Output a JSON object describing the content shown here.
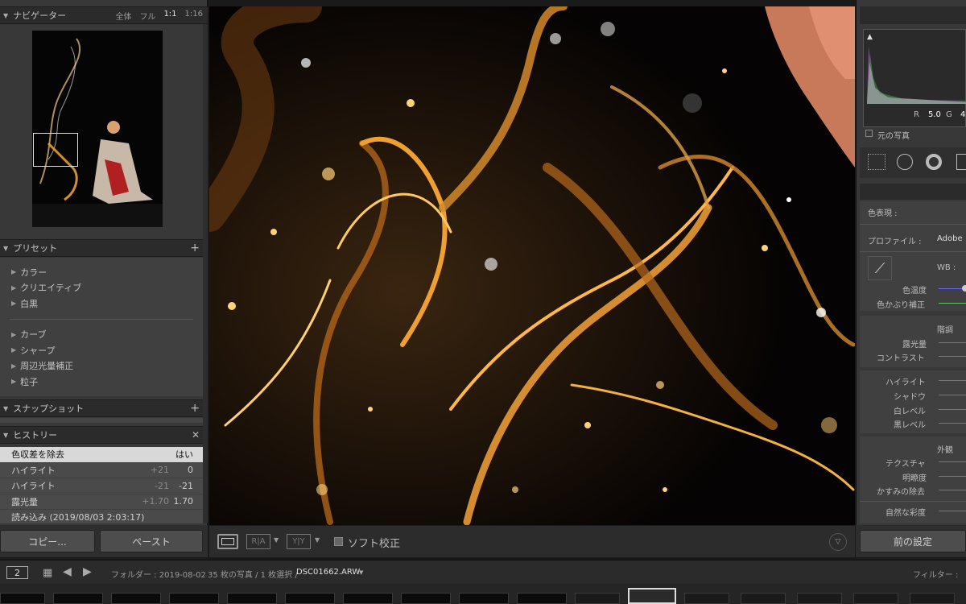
{
  "navigator": {
    "title": "ナビゲーター",
    "options": [
      "全体",
      "フル",
      "1:1",
      "1:16"
    ],
    "active_option": "1:1"
  },
  "presets": {
    "title": "プリセット",
    "group1": [
      "カラー",
      "クリエイティブ",
      "白黒"
    ],
    "group2": [
      "カーブ",
      "シャープ",
      "周辺光量補正",
      "粒子"
    ]
  },
  "snapshot": {
    "title": "スナップショット"
  },
  "history": {
    "title": "ヒストリー",
    "rows": [
      {
        "name": "色収差を除去",
        "delta": "",
        "value": "はい",
        "selected": true
      },
      {
        "name": "ハイライト",
        "delta": "+21",
        "value": "0"
      },
      {
        "name": "ハイライト",
        "delta": "-21",
        "value": "-21"
      },
      {
        "name": "露光量",
        "delta": "+1.70",
        "value": "1.70"
      },
      {
        "name": "読み込み (2019/08/03 2:03:17)",
        "delta": "",
        "value": ""
      }
    ]
  },
  "buttons": {
    "copy": "コピー...",
    "paste": "ペースト",
    "previous": "前の設定"
  },
  "toolbar": {
    "soft_proof": "ソフト校正"
  },
  "right": {
    "histogram_readout": {
      "r_label": "R",
      "r_value": "5.0",
      "g_label": "G",
      "g_value": "4"
    },
    "original_photo": "元の写真",
    "color_rep": "色表現 :",
    "profile_label": "プロファイル :",
    "profile_value": "Adobe",
    "wb": "WB :",
    "temp": "色温度",
    "tint": "色かぶり補正",
    "tone": "階調",
    "exposure": "露光量",
    "contrast": "コントラスト",
    "highlights": "ハイライト",
    "shadows": "シャドウ",
    "whites": "白レベル",
    "blacks": "黒レベル",
    "presence": "外観",
    "texture": "テクスチャ",
    "clarity": "明瞭度",
    "dehaze": "かすみの除去",
    "vibrance": "自然な彩度"
  },
  "filmstrip": {
    "screen_num": "2",
    "folder": "フォルダー : 2019-08-02",
    "count": "35 枚の写真 / 1 枚選択 /",
    "filename": "DSC01662.ARW",
    "filter": "フィルター :"
  },
  "colors": {
    "accent_selected": "#d8d8d8",
    "panel": "#383838",
    "flame": "#e8a030"
  }
}
